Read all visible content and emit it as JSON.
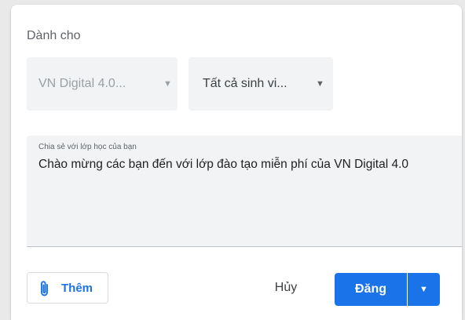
{
  "dialog": {
    "audience_label": "Dành cho",
    "class_select": {
      "value": "VN Digital 4.0...",
      "caret": "▼"
    },
    "students_select": {
      "value": "Tất cả sinh vi...",
      "caret": "▼"
    },
    "share": {
      "label": "Chia sẻ với lớp học của bạn",
      "value": "Chào mừng các bạn đến với lớp đào tạo miễn phí của VN Digital 4.0"
    },
    "actions": {
      "add_label": "Thêm",
      "add_icon": "paperclip-icon",
      "cancel_label": "Hủy",
      "post_label": "Đăng",
      "post_menu_caret": "▼"
    }
  },
  "colors": {
    "accent": "#1a73e8",
    "field_background": "#f1f3f4",
    "muted_text": "#5f6368"
  }
}
